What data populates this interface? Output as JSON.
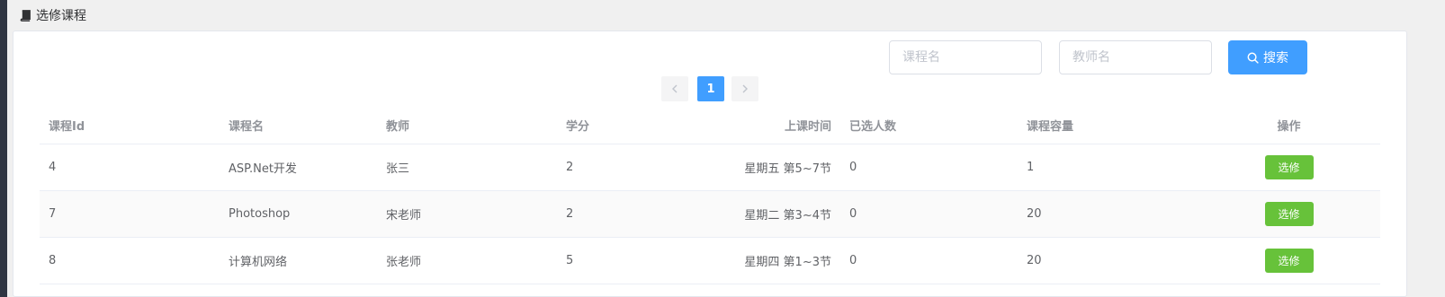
{
  "header": {
    "title": "选修课程"
  },
  "search": {
    "course_placeholder": "课程名",
    "teacher_placeholder": "教师名",
    "button_label": "搜索"
  },
  "pagination": {
    "current_page": "1"
  },
  "table": {
    "columns": [
      "课程Id",
      "课程名",
      "教师",
      "学分",
      "上课时间",
      "已选人数",
      "课程容量",
      "操作"
    ],
    "rows": [
      {
        "id": "4",
        "name": "ASP.Net开发",
        "teacher": "张三",
        "credit": "2",
        "time": "星期五 第5~7节",
        "enrolled": "0",
        "capacity": "1",
        "action": "选修"
      },
      {
        "id": "7",
        "name": "Photoshop",
        "teacher": "宋老师",
        "credit": "2",
        "time": "星期二 第3~4节",
        "enrolled": "0",
        "capacity": "20",
        "action": "选修"
      },
      {
        "id": "8",
        "name": "计算机网络",
        "teacher": "张老师",
        "credit": "5",
        "time": "星期四 第1~3节",
        "enrolled": "0",
        "capacity": "20",
        "action": "选修"
      }
    ]
  },
  "icons": {
    "header": "book-icon",
    "search": "search-icon",
    "prev": "chevron-left-icon",
    "next": "chevron-right-icon"
  },
  "colors": {
    "primary": "#409eff",
    "success": "#67c23a",
    "header_text": "#909399"
  }
}
